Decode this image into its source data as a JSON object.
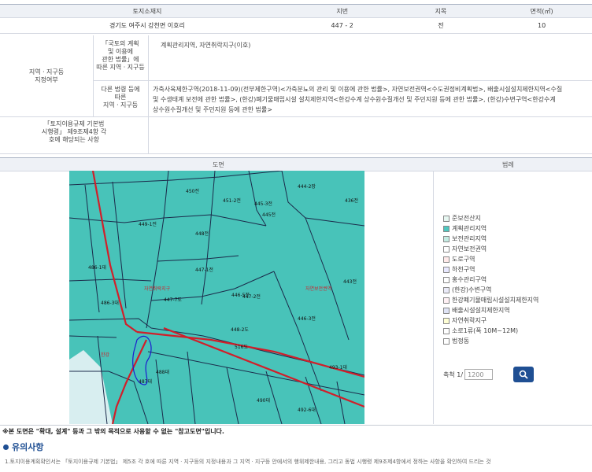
{
  "land_table": {
    "headers": [
      "토지소재지",
      "지번",
      "지목",
      "면적(㎡)"
    ],
    "row": [
      "경기도 여주시 강천면 이호리",
      "447 - 2",
      "전",
      "10"
    ]
  },
  "zoning": {
    "section_label": "지역ㆍ지구등\n지정여부",
    "sub1_label": "「국토의 계획\n및 이용에\n관한 법률」에\n따른 지역ㆍ지구등",
    "sub1_value": "계획관리지역, 자연취락지구(이호)",
    "sub2_label": "다른 법령 등에\n따른\n지역ㆍ지구등",
    "sub2_lines": [
      "가축사육제한구역(2018-11-09)(전부제한구역)<가축분뇨의 관리 및 이용에 관한 법률>, 자연보전권역<수도권정비계획법>, 배출시설설치제한지역<수질",
      "및 수생태계 보전에 관한 법률>, (한강)폐기물매립시설 설치제한지역<한강수계 상수원수질개선 및 주민지원 등에 관한 법률>, (한강)수변구역<한강수계",
      "상수원수질개선 및 주민지원 등에 관한 법률>"
    ],
    "sub3_label": "「토지이용규제 기본법\n시행령」 제9조제4항 각\n호에 해당되는 사항"
  },
  "map_section": {
    "map_label": "도면",
    "legend_label": "범례"
  },
  "map_labels": [
    "450전",
    "444-2장",
    "451-2전",
    "445-3전",
    "445전",
    "436전",
    "449-1전",
    "448전",
    "447-1전",
    "446-5전",
    "447-7도",
    "486-3대",
    "486-1대",
    "516도",
    "488대",
    "487대",
    "493-1대",
    "490대",
    "492-6대",
    "443전",
    "447-2전",
    "446-3전",
    "448-2도",
    "자연취락지구",
    "자연보전권역",
    "한강"
  ],
  "legend": [
    {
      "label": "준보전산지",
      "color": "#e6f7f1"
    },
    {
      "label": "계획관리지역",
      "color": "#4fc7bf"
    },
    {
      "label": "보전관리지역",
      "color": "#c4ece3"
    },
    {
      "label": "자연보전권역",
      "color": "#ffffff"
    },
    {
      "label": "도로구역",
      "color": "#ffe9e9"
    },
    {
      "label": "하천구역",
      "color": "#e8e8ff"
    },
    {
      "label": "홍수관리구역",
      "color": "#ffffff"
    },
    {
      "label": "(한강)수변구역",
      "color": "#eaeaf8"
    },
    {
      "label": "한강폐기물매립시설설치제한지역",
      "color": "#fff0f4"
    },
    {
      "label": "배출시설설치제한지역",
      "color": "#dfe3f5"
    },
    {
      "label": "자연취락지구",
      "color": "#ffffd4"
    },
    {
      "label": "소로1류(폭 10M~12M)",
      "color": "#ffffff"
    },
    {
      "label": "법정동",
      "color": "#ffffff"
    }
  ],
  "scale": {
    "label": "축척 1/",
    "value": "1200"
  },
  "note": "※본 도면은 \"확대, 설계\" 등과 그 밖의 목적으로 사용할 수 없는 \"참고도면\"입니다.",
  "caution_title": "유의사항",
  "caution_text": "1.토지이용계획확인서는 「토지이용규제 기본법」 제5조 각 호에 따른 지역ㆍ지구등의 지정내용과 그 지역ㆍ지구등 안에서의 행위제한내용, 그리고 동법 시행령 제9조제4항에서 정하는 사항을 확인하여 드리는 것"
}
